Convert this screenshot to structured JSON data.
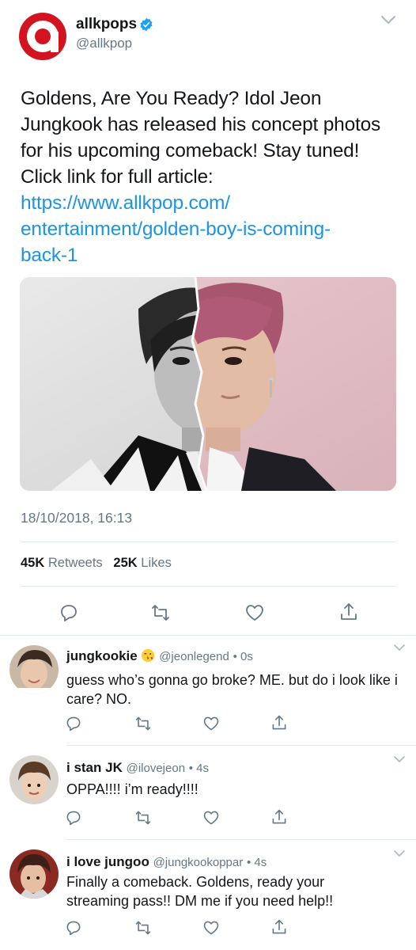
{
  "tweet": {
    "display_name": "allkpops",
    "handle": "@allkpop",
    "text": "Goldens, Are You Ready? Idol Jeon Jungkook has released his concept photos for his upcoming comeback! Stay tuned! Click link for full article:",
    "link_line1": "https://www.allkpop.com/",
    "link_line2": "entertainment/golden-boy-is-coming-",
    "link_line3": "back-1",
    "timestamp": "18/10/2018, 16:13",
    "retweets_count": "45K",
    "retweets_label": "Retweets",
    "likes_count": "25K",
    "likes_label": "Likes",
    "brand_color": "#d31420",
    "link_color": "#1b95e0"
  },
  "replies": [
    {
      "name": "jungkookie",
      "emoji": "face-blowing-kiss",
      "handle": "@jeonlegend",
      "time": "• 0s",
      "text": "guess who’s gonna go broke? ME. but do i look like i care? NO."
    },
    {
      "name": "i stan JK",
      "handle": "@ilovejeon",
      "time": "• 4s",
      "text": "OPPA!!!! i’m ready!!!!"
    },
    {
      "name": "i love jungoo",
      "handle": "@jungkookoppar",
      "time": "• 4s",
      "text": "Finally a comeback. Goldens, ready your streaming pass!! DM me if you need help!!"
    }
  ],
  "icons": {
    "reply": "reply-icon",
    "retweet": "retweet-icon",
    "like": "heart-icon",
    "share": "share-icon",
    "verified": "verified-badge-icon",
    "more": "chevron-down-icon"
  }
}
